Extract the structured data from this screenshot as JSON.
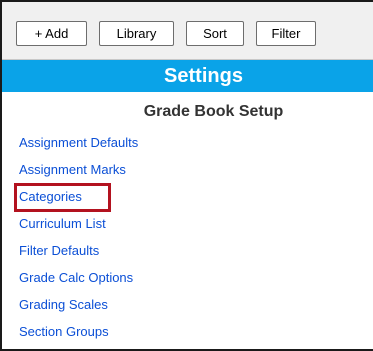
{
  "toolbar": {
    "add_label": "+ Add",
    "library_label": "Library",
    "sort_label": "Sort",
    "filter_label": "Filter"
  },
  "header": {
    "title": "Settings"
  },
  "section": {
    "title": "Grade Book Setup",
    "links": [
      "Assignment Defaults",
      "Assignment Marks",
      "Categories",
      "Curriculum List",
      "Filter Defaults",
      "Grade Calc Options",
      "Grading Scales",
      "Section Groups"
    ],
    "highlighted_item": "Categories"
  },
  "colors": {
    "header_bar": "#0aa3e8",
    "link": "#0b4fd6",
    "highlight_border": "#b3121f",
    "toolbar_bg": "#f0f0f0"
  }
}
